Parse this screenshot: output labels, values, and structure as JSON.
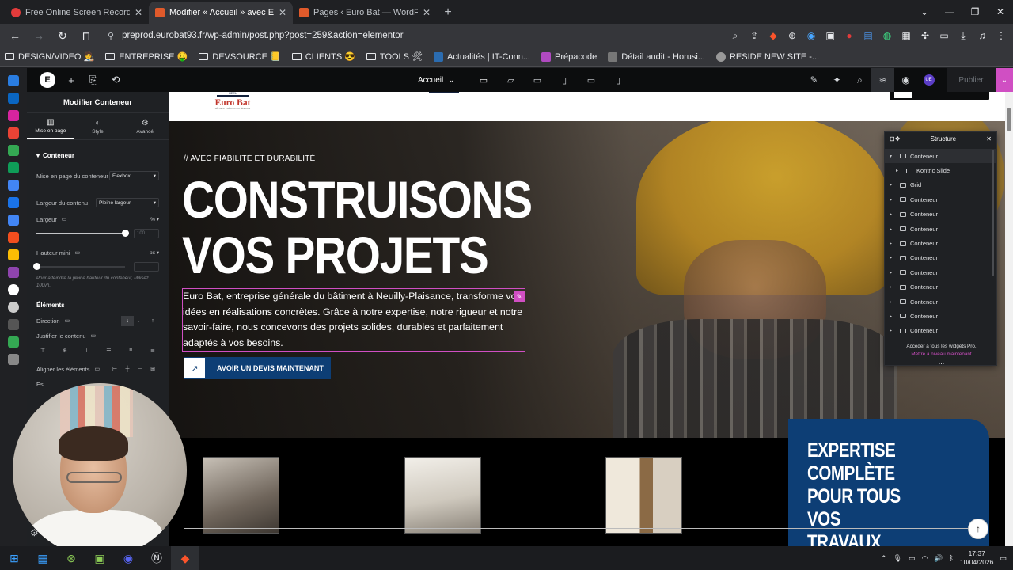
{
  "browser": {
    "tabs": [
      {
        "title": "Free Online Screen Recorder - Re",
        "favicon_color": "#e23b3b",
        "active": false
      },
      {
        "title": "Modifier « Accueil » avec Elemen",
        "favicon_color": "#e05a2b",
        "active": true
      },
      {
        "title": "Pages ‹ Euro Bat — WordPress",
        "favicon_color": "#e05a2b",
        "active": false
      }
    ],
    "url": "preprod.eurobat93.fr/wp-admin/post.php?post=259&action=elementor",
    "bookmarks": [
      {
        "label": "DESIGN/VIDEO 🧑‍🎨",
        "type": "folder"
      },
      {
        "label": "ENTREPRISE 🤑",
        "type": "folder"
      },
      {
        "label": "DEVSOURCE 📒",
        "type": "folder"
      },
      {
        "label": "CLIENTS 😎",
        "type": "folder"
      },
      {
        "label": "TOOLS 🛠",
        "type": "folder"
      },
      {
        "label": "Actualités | IT-Conn...",
        "type": "link"
      },
      {
        "label": "Prépacode",
        "type": "link"
      },
      {
        "label": "Détail audit - Horusi...",
        "type": "link"
      },
      {
        "label": "RESIDE NEW SITE -...",
        "type": "link"
      }
    ]
  },
  "elementor": {
    "page_selector": "Accueil",
    "publish_label": "Publier",
    "user_initials": "UE",
    "panel": {
      "title": "Modifier Conteneur",
      "tabs": [
        "Mise en page",
        "Style",
        "Avancé"
      ],
      "section_title": "Conteneur",
      "layout_label": "Mise en page du conteneur",
      "layout_value": "Flexbox",
      "content_width_label": "Largeur du contenu",
      "content_width_value": "Pleine largeur",
      "width_label": "Largeur",
      "width_unit": "%",
      "width_value": "100",
      "width_fill": 1.0,
      "min_height_label": "Hauteur mini",
      "min_height_unit": "px",
      "min_height_hint": "Pour atteindre la pleine hauteur du conteneur, utilisez 100vh.",
      "elements_title": "Éléments",
      "direction_label": "Direction",
      "justify_label": "Justifier le contenu",
      "align_label": "Aligner les éléments",
      "partial_label": "Es"
    },
    "structure": {
      "title": "Structure",
      "items": [
        "Conteneur",
        "Kontric Slide",
        "Grid",
        "Conteneur",
        "Conteneur",
        "Conteneur",
        "Conteneur",
        "Conteneur",
        "Conteneur",
        "Conteneur",
        "Conteneur",
        "Conteneur",
        "Conteneur"
      ],
      "footer_text": "Accéder à tous les widgets Pro.",
      "footer_link": "Mettre à niveau maintenant",
      "more": "..."
    }
  },
  "site": {
    "logo_top": "HEEL",
    "logo_name": "Euro Bat",
    "logo_sub": "BÂTIMENT · RÉNOVATION · ÉNERGIE",
    "tagline": "// AVEC FIABILITÉ ET DURABILITÉ",
    "headline_line1": "CONSTRUISONS",
    "headline_line2": "VOS PROJETS",
    "description": "Euro Bat, entreprise générale du bâtiment à Neuilly-Plaisance, transforme vos idées en réalisations concrètes. Grâce à notre expertise, notre rigueur et notre savoir-faire, nous concevons des projets solides, durables et parfaitement adaptés à vos besoins.",
    "cta_label": "AVOIR UN DEVIS MAINTENANT",
    "expertise_line1": "EXPERTISE",
    "expertise_line2": "COMPLÈTE",
    "expertise_line3": "POUR TOUS",
    "expertise_line4": "VOS",
    "expertise_line5": "TRAVAUX"
  },
  "taskbar": {
    "time": "17:37",
    "date": "10/04/2026"
  },
  "colors": {
    "brand_blue": "#0d3e75",
    "elementor_accent": "#d04fc3",
    "logo_red": "#c1352b"
  }
}
